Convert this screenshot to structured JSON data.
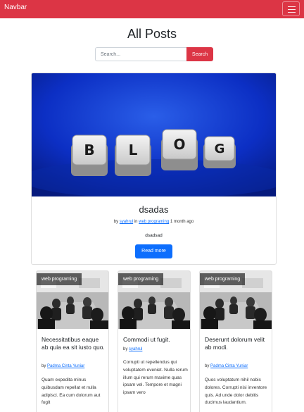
{
  "navbar": {
    "brand": "Navbar",
    "toggler_icon": "menu-icon"
  },
  "page": {
    "title": "All Posts"
  },
  "search": {
    "placeholder": "Search...",
    "button_label": "Search"
  },
  "featured_post": {
    "image_text": "BLOG",
    "title": "dsadas",
    "meta_prefix": "by",
    "author": "syahrul",
    "meta_in": "in",
    "category": "web programing",
    "time_ago": "1 month ago",
    "excerpt": "dsadsad",
    "read_more_label": "Read more"
  },
  "posts": [
    {
      "category": "web programing",
      "title": "Necessitatibus eaque ab quia ea sit iusto quo.",
      "author_prefix": "by",
      "author": "Padma Cinta Yuniar",
      "excerpt": "Quam expedita minus quibusdam repellat et nulla adipisci. Ea cum dolorum aut fugit"
    },
    {
      "category": "web programing",
      "title": "Commodi ut fugit.",
      "author_prefix": "by",
      "author": "syahrul",
      "excerpt": "Corrupti ut repellendus qui voluptatem eveniet. Nulla rerum illum qui rerum maxime quas ipsam vel. Tempore et magni ipsam vero"
    },
    {
      "category": "web programing",
      "title": "Deserunt dolorum velit ab modi.",
      "author_prefix": "by",
      "author": "Padma Cinta Yuniar",
      "excerpt": "Quos voluptatum nihil nobis dolores. Corrupti nisi inventore quis. Ad unde dolor debitis ducimus laudantium."
    }
  ],
  "colors": {
    "navbar": "#dc3545",
    "search_button": "#dc3545",
    "primary_button": "#0d6efd",
    "link": "#0d6efd"
  }
}
